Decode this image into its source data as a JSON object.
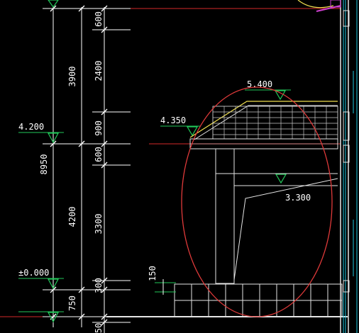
{
  "colors": {
    "background": "#000000",
    "dimension_line": "#ffffff",
    "level_marker": "#22c95a",
    "level_text": "#ffffff",
    "grid_red": "#d42a2a",
    "highlight_ellipse": "#e03a3a",
    "cyan": "#1ec8e0",
    "yellow": "#f0e050",
    "magenta": "#d040d0",
    "structure": "#e6e6e6"
  },
  "left_dimensions": {
    "total": "8950",
    "upper": "3900",
    "lower": "4200",
    "bottom": "750",
    "base": "50"
  },
  "right_dimensions": [
    "600",
    "2400",
    "900",
    "600",
    "3300",
    "300"
  ],
  "levels": [
    {
      "id": "level-4200",
      "label": "4.200"
    },
    {
      "id": "level-0000",
      "label": "±0.000"
    },
    {
      "id": "level-5400",
      "label": "5.400"
    },
    {
      "id": "level-4350",
      "label": "4.350"
    },
    {
      "id": "level-3300",
      "label": "3.300"
    }
  ],
  "detail_dimension": "150"
}
